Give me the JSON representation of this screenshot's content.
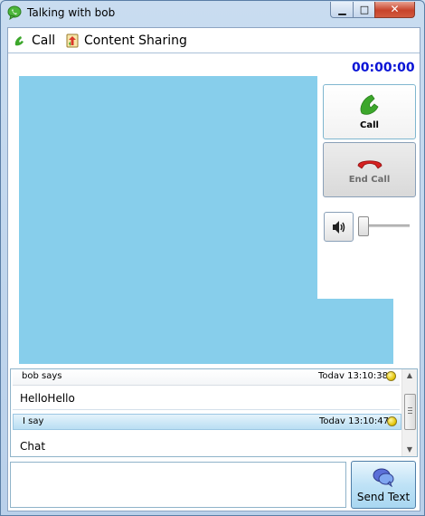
{
  "window": {
    "title": "Talking with bob",
    "controls": {
      "minimize": "▁",
      "maximize": "□",
      "close": "✕"
    }
  },
  "toolbar": {
    "call_label": "Call",
    "content_sharing_label": "Content Sharing"
  },
  "call": {
    "timer": "00:00:00",
    "call_button_label": "Call",
    "end_call_button_label": "End Call",
    "volume_level": 0.0
  },
  "chat": {
    "messages": [
      {
        "sender": "bob says",
        "time": "Todav 13:10:38",
        "text": "HelloHello"
      },
      {
        "sender": "I say",
        "time": "Todav 13:10:47",
        "text": "Chat"
      }
    ]
  },
  "composer": {
    "value": "",
    "send_label": "Send Text"
  },
  "icons": {
    "title": "chat-bubble-icon",
    "call": "phone-icon",
    "sharing": "content-sharing-icon",
    "volume": "speaker-icon",
    "send": "chat-bubbles-icon"
  },
  "colors": {
    "video_bg": "#87ceeb",
    "timer": "#0a14d6",
    "call_green": "#3ca72b",
    "end_red": "#d62020"
  }
}
